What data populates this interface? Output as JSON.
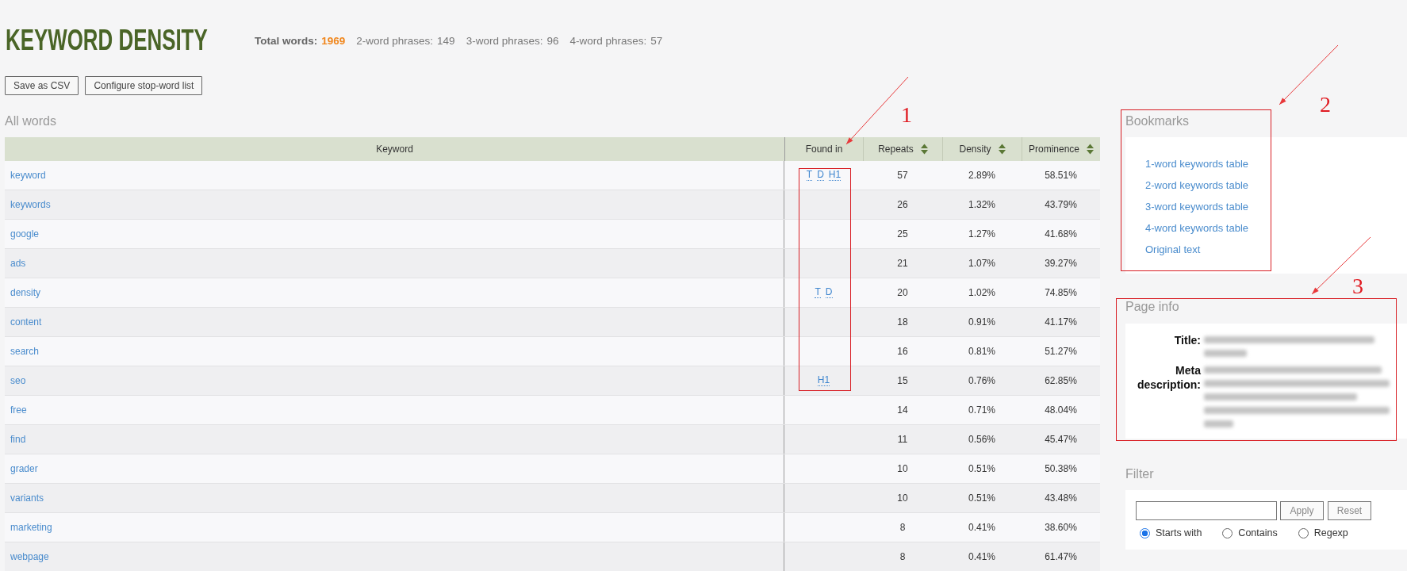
{
  "header": {
    "title": "KEYWORD DENSITY",
    "stats": [
      {
        "kind": "total",
        "label": "Total words:",
        "value": "1969"
      },
      {
        "kind": "phrase",
        "label": "2-word phrases:",
        "value": "149"
      },
      {
        "kind": "phrase",
        "label": "3-word phrases:",
        "value": "96"
      },
      {
        "kind": "phrase",
        "label": "4-word phrases:",
        "value": "57"
      }
    ]
  },
  "toolbar": {
    "buttons": [
      "Save as CSV",
      "Configure stop-word list"
    ]
  },
  "all_words": {
    "heading": "All words",
    "columns": [
      {
        "label": "Keyword",
        "sortable": false
      },
      {
        "label": "Found in",
        "sortable": false
      },
      {
        "label": "Repeats",
        "sortable": true
      },
      {
        "label": "Density",
        "sortable": true
      },
      {
        "label": "Prominence",
        "sortable": true
      }
    ],
    "rows": [
      {
        "keyword": "keyword",
        "found_in": [
          "T",
          "D",
          "H1"
        ],
        "repeats": "57",
        "density": "2.89%",
        "prominence": "58.51%"
      },
      {
        "keyword": "keywords",
        "repeats": "26",
        "density": "1.32%",
        "prominence": "43.79%"
      },
      {
        "keyword": "google",
        "repeats": "25",
        "density": "1.27%",
        "prominence": "41.68%"
      },
      {
        "keyword": "ads",
        "repeats": "21",
        "density": "1.07%",
        "prominence": "39.27%"
      },
      {
        "keyword": "density",
        "found_in": [
          "T",
          "D"
        ],
        "repeats": "20",
        "density": "1.02%",
        "prominence": "74.85%"
      },
      {
        "keyword": "content",
        "repeats": "18",
        "density": "0.91%",
        "prominence": "41.17%"
      },
      {
        "keyword": "search",
        "repeats": "16",
        "density": "0.81%",
        "prominence": "51.27%"
      },
      {
        "keyword": "seo",
        "found_in": [
          "H1"
        ],
        "repeats": "15",
        "density": "0.76%",
        "prominence": "62.85%"
      },
      {
        "keyword": "free",
        "repeats": "14",
        "density": "0.71%",
        "prominence": "48.04%"
      },
      {
        "keyword": "find",
        "repeats": "11",
        "density": "0.56%",
        "prominence": "45.47%"
      },
      {
        "keyword": "grader",
        "repeats": "10",
        "density": "0.51%",
        "prominence": "50.38%"
      },
      {
        "keyword": "variants",
        "repeats": "10",
        "density": "0.51%",
        "prominence": "43.48%"
      },
      {
        "keyword": "marketing",
        "repeats": "8",
        "density": "0.41%",
        "prominence": "38.60%"
      },
      {
        "keyword": "webpage",
        "repeats": "8",
        "density": "0.41%",
        "prominence": "61.47%"
      }
    ]
  },
  "bookmarks": {
    "heading": "Bookmarks",
    "links": [
      "1-word keywords table",
      "2-word keywords table",
      "3-word keywords table",
      "4-word keywords table",
      "Original text"
    ]
  },
  "page_info": {
    "heading": "Page info",
    "fields": [
      {
        "label": "Title:"
      },
      {
        "label": "Meta description:"
      }
    ]
  },
  "filter": {
    "heading": "Filter",
    "buttons": [
      "Apply",
      "Reset"
    ],
    "options": [
      {
        "label": "Starts with",
        "selected": true
      },
      {
        "label": "Contains",
        "selected": false
      },
      {
        "label": "Regexp",
        "selected": false
      }
    ]
  },
  "annotations": [
    {
      "label": "1"
    },
    {
      "label": "2"
    },
    {
      "label": "3"
    }
  ]
}
